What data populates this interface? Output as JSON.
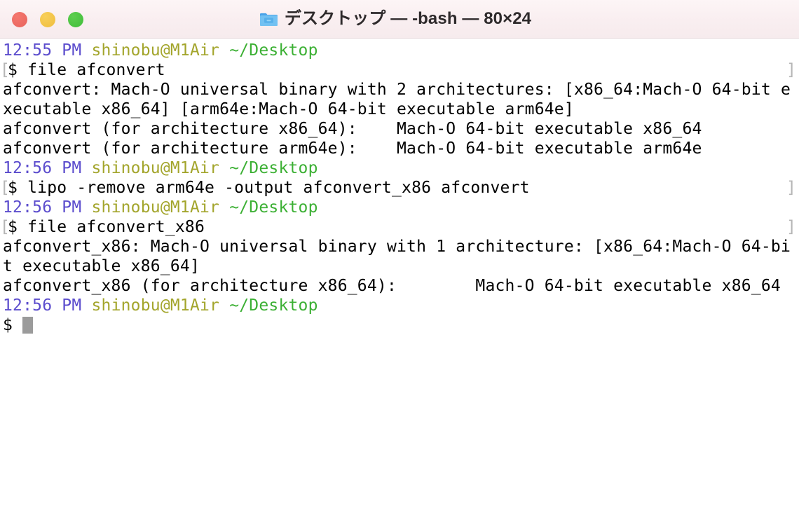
{
  "window": {
    "title": "デスクトップ — -bash — 80×24",
    "folder_icon": "folder-icon",
    "traffic_lights": [
      {
        "name": "close",
        "label": "Close",
        "color": "#e8635c"
      },
      {
        "name": "minimize",
        "label": "Minimize",
        "color": "#efbd3d"
      },
      {
        "name": "maximize",
        "label": "Zoom",
        "color": "#40bd39"
      }
    ]
  },
  "theme": {
    "titlebar_bg": "#faf0f2",
    "terminal_bg": "#ffffff",
    "text": "#000000",
    "time_color": "#5b4ccd",
    "user_color": "#a3a52c",
    "path_color": "#3cb034",
    "marker_color": "#b6b6b6",
    "cursor_color": "#9b9b9b"
  },
  "terminal": {
    "columns": 80,
    "rows": 24,
    "shell": "-bash",
    "lines": [
      {
        "type": "prompt-info",
        "time": "12:55 PM",
        "user_host": "shinobu@M1Air",
        "path": "~/Desktop"
      },
      {
        "type": "command",
        "left_marker": "[",
        "sigil": "$ ",
        "command": "file afconvert",
        "right_marker": "]"
      },
      {
        "type": "output",
        "text": "afconvert: Mach-O universal binary with 2 architectures: [x86_64:Mach-O 64-bit e"
      },
      {
        "type": "output",
        "text": "xecutable x86_64] [arm64e:Mach-O 64-bit executable arm64e]"
      },
      {
        "type": "output",
        "text": "afconvert (for architecture x86_64):\tMach-O 64-bit executable x86_64"
      },
      {
        "type": "output",
        "text": "afconvert (for architecture arm64e):\tMach-O 64-bit executable arm64e"
      },
      {
        "type": "prompt-info",
        "time": "12:56 PM",
        "user_host": "shinobu@M1Air",
        "path": "~/Desktop"
      },
      {
        "type": "command",
        "left_marker": "[",
        "sigil": "$ ",
        "command": "lipo -remove arm64e -output afconvert_x86 afconvert",
        "right_marker": "]"
      },
      {
        "type": "prompt-info",
        "time": "12:56 PM",
        "user_host": "shinobu@M1Air",
        "path": "~/Desktop"
      },
      {
        "type": "command",
        "left_marker": "[",
        "sigil": "$ ",
        "command": "file afconvert_x86",
        "right_marker": "]"
      },
      {
        "type": "output",
        "text": "afconvert_x86: Mach-O universal binary with 1 architecture: [x86_64:Mach-O 64-bi"
      },
      {
        "type": "output",
        "text": "t executable x86_64]"
      },
      {
        "type": "output",
        "text": "afconvert_x86 (for architecture x86_64):\tMach-O 64-bit executable x86_64"
      },
      {
        "type": "prompt-info",
        "time": "12:56 PM",
        "user_host": "shinobu@M1Air",
        "path": "~/Desktop"
      },
      {
        "type": "active-prompt",
        "sigil": "$ ",
        "cursor": true
      }
    ]
  }
}
